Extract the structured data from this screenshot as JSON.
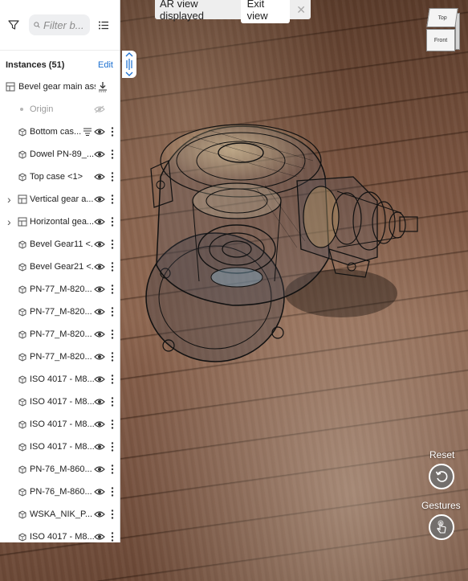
{
  "ar_banner": {
    "status_text": "AR view displayed",
    "exit_label": "Exit view",
    "close_glyph": "✕"
  },
  "viewcube": {
    "top_label": "Top",
    "front_label": "Front"
  },
  "panel": {
    "search_placeholder": "Filter b...",
    "header_title": "Instances (51)",
    "edit_label": "Edit",
    "root_item": {
      "label": "Bevel gear main ass...",
      "icon": "assembly-icon"
    },
    "items": [
      {
        "label": "Origin",
        "type": "origin",
        "visibility": "hidden",
        "expandable": false
      },
      {
        "label": "Bottom cas...",
        "type": "part",
        "visibility": "visible",
        "expandable": false,
        "extra": "section-icon"
      },
      {
        "label": "Dowel PN-89_...",
        "type": "part",
        "visibility": "visible",
        "expandable": false
      },
      {
        "label": "Top case <1>",
        "type": "part",
        "visibility": "visible",
        "expandable": false
      },
      {
        "label": "Vertical gear a...",
        "type": "assembly",
        "visibility": "visible",
        "expandable": true
      },
      {
        "label": "Horizontal gea...",
        "type": "assembly",
        "visibility": "visible",
        "expandable": true
      },
      {
        "label": "Bevel Gear11 <...",
        "type": "part",
        "visibility": "visible",
        "expandable": false
      },
      {
        "label": "Bevel Gear21 <...",
        "type": "part",
        "visibility": "visible",
        "expandable": false
      },
      {
        "label": "PN-77_M-820...",
        "type": "part",
        "visibility": "visible",
        "expandable": false
      },
      {
        "label": "PN-77_M-820...",
        "type": "part",
        "visibility": "visible",
        "expandable": false
      },
      {
        "label": "PN-77_M-820...",
        "type": "part",
        "visibility": "visible",
        "expandable": false
      },
      {
        "label": "PN-77_M-820...",
        "type": "part",
        "visibility": "visible",
        "expandable": false
      },
      {
        "label": "ISO 4017 - M8...",
        "type": "part",
        "visibility": "visible",
        "expandable": false
      },
      {
        "label": "ISO 4017 - M8...",
        "type": "part",
        "visibility": "visible",
        "expandable": false
      },
      {
        "label": "ISO 4017 - M8...",
        "type": "part",
        "visibility": "visible",
        "expandable": false
      },
      {
        "label": "ISO 4017 - M8...",
        "type": "part",
        "visibility": "visible",
        "expandable": false
      },
      {
        "label": "PN-76_M-860...",
        "type": "part",
        "visibility": "visible",
        "expandable": false
      },
      {
        "label": "PN-76_M-860...",
        "type": "part",
        "visibility": "visible",
        "expandable": false
      },
      {
        "label": "WSKA_NIK_P...",
        "type": "part",
        "visibility": "visible",
        "expandable": false
      },
      {
        "label": "ISO 4017 - M8...",
        "type": "part",
        "visibility": "visible",
        "expandable": false
      }
    ]
  },
  "controls": {
    "reset_label": "Reset",
    "gestures_label": "Gestures"
  },
  "colors": {
    "accent": "#1b6fd0",
    "panel_bg": "#ffffff",
    "banner_bg": "#eeeeee"
  }
}
